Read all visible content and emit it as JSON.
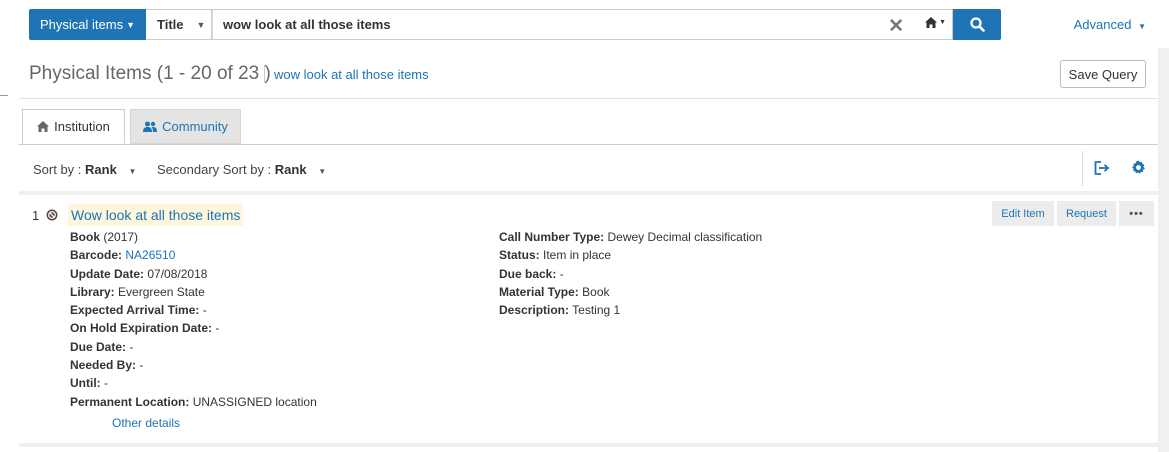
{
  "search": {
    "scope_label": "Physical items",
    "field_label": "Title",
    "query_value": "wow look at all those items",
    "advanced_label": "Advanced"
  },
  "results": {
    "title": "Physical Items (1 - 20 of 23 )",
    "query_link": "wow look at all those items",
    "save_query_label": "Save Query"
  },
  "tabs": [
    {
      "label": "Institution",
      "icon": "home-icon",
      "active": true
    },
    {
      "label": "Community",
      "icon": "users-icon",
      "active": false
    }
  ],
  "sort": {
    "primary_label": "Sort by :",
    "primary_value": "Rank",
    "secondary_label": "Secondary Sort by :",
    "secondary_value": "Rank"
  },
  "item": {
    "number": "1",
    "title": "Wow look at all those items",
    "type": "Book",
    "year": "(2017)",
    "barcode_label": "Barcode:",
    "barcode": "NA26510",
    "update_date_label": "Update Date:",
    "update_date": "07/08/2018",
    "library_label": "Library:",
    "library": "Evergreen State",
    "expected_arrival_label": "Expected Arrival Time:",
    "expected_arrival": "-",
    "on_hold_exp_label": "On Hold Expiration Date:",
    "on_hold_exp": "-",
    "due_date_label": "Due Date:",
    "due_date": "-",
    "needed_by_label": "Needed By:",
    "needed_by": "-",
    "until_label": "Until:",
    "until": "-",
    "permanent_location_label": "Permanent Location:",
    "permanent_location": "UNASSIGNED location",
    "call_number_type_label": "Call Number Type:",
    "call_number_type": "Dewey Decimal classification",
    "status_label": "Status:",
    "status": "Item in place",
    "due_back_label": "Due back:",
    "due_back": "-",
    "material_type_label": "Material Type:",
    "material_type": "Book",
    "description_label": "Description:",
    "description": "Testing 1",
    "other_details_label": "Other details",
    "actions": {
      "edit": "Edit Item",
      "request": "Request",
      "more": "•••"
    }
  },
  "colors": {
    "accent": "#1e74b4",
    "title_highlight": "#fdf6dc"
  }
}
